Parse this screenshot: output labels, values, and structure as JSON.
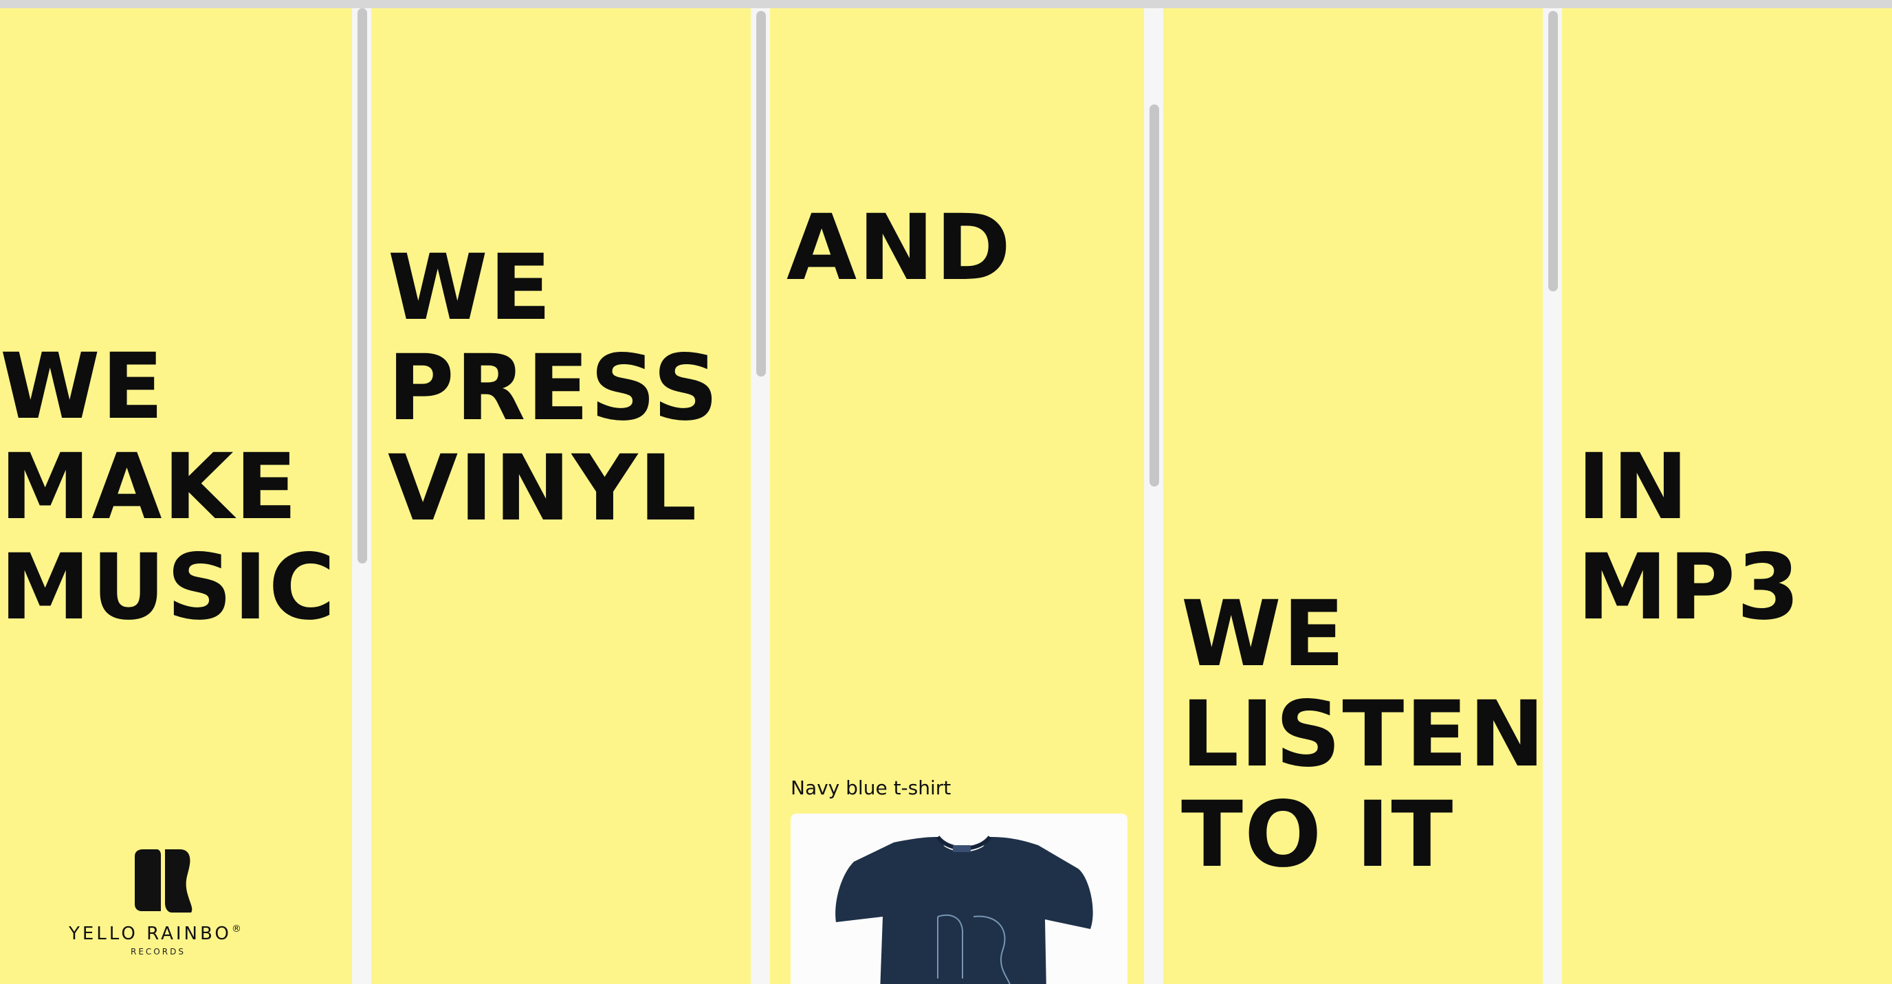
{
  "panels": [
    {
      "lines": [
        "WE",
        "MAKE",
        "MUSIC"
      ]
    },
    {
      "lines": [
        "WE",
        "PRESS",
        "VINYL"
      ]
    },
    {
      "lines": [
        "AND"
      ]
    },
    {
      "lines": [
        "WE",
        "LISTEN",
        "TO IT"
      ]
    },
    {
      "lines": [
        "IN",
        "MP3"
      ]
    }
  ],
  "logo": {
    "name": "YELLO RAINBO",
    "registered": "®",
    "sub": "RECORDS"
  },
  "product": {
    "label": "Navy blue t-shirt",
    "icon": "tshirt-image"
  },
  "colors": {
    "background": "#fdf58a",
    "text": "#0d0d0d",
    "tshirt": "#1e3148",
    "scrollbar_thumb": "#c6c6c6",
    "scrollbar_track": "#f6f6f6"
  },
  "scroll": [
    {
      "position": 0.0,
      "visible_fraction": 0.33
    },
    {
      "position": 0.0,
      "visible_fraction": 0.22
    },
    {
      "position": 0.05,
      "visible_fraction": 0.22
    },
    {
      "position": 0.0,
      "visible_fraction": 0.16
    }
  ]
}
